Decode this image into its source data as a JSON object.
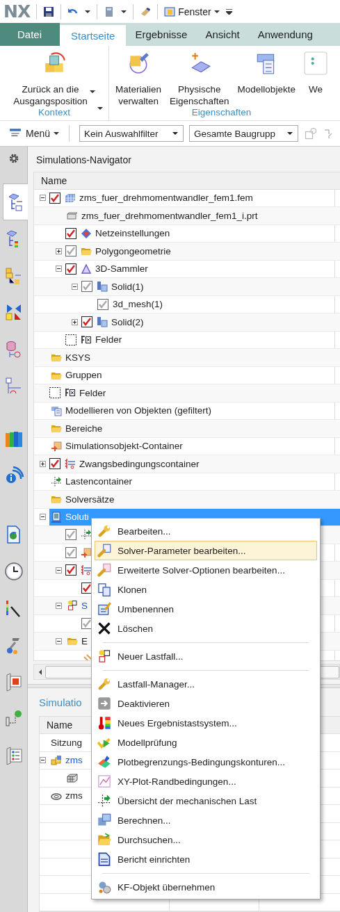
{
  "quick_access": {
    "logo": "NX",
    "window_menu": "Fenster"
  },
  "tabs": [
    {
      "label": "Datei",
      "kind": "file",
      "selected": false
    },
    {
      "label": "Startseite",
      "kind": "tab",
      "selected": true
    },
    {
      "label": "Ergebnisse",
      "kind": "tab",
      "selected": false
    },
    {
      "label": "Ansicht",
      "kind": "tab",
      "selected": false
    },
    {
      "label": "Anwendung",
      "kind": "tab",
      "selected": false
    }
  ],
  "ribbon": {
    "groups": [
      {
        "label": "Kontext",
        "launcher": true,
        "buttons": [
          {
            "kind": "home",
            "lines": [
              "Zurück an die",
              "Ausgangsposition"
            ],
            "dropdown": true
          }
        ]
      },
      {
        "label": "Eigenschaften",
        "buttons": [
          {
            "kind": "material",
            "lines": [
              "Materialien",
              "verwalten"
            ]
          },
          {
            "kind": "physical",
            "lines": [
              "Physische",
              "Eigenschaften"
            ]
          },
          {
            "kind": "model",
            "lines": [
              "Modellobjekte"
            ]
          },
          {
            "kind": "more",
            "lines": [
              "We"
            ]
          }
        ]
      }
    ]
  },
  "toolbar": {
    "menu": "Menü",
    "selection_filter": "Kein Auswahlfilter",
    "scope": "Gesamte Baugrupp"
  },
  "sidebar": {
    "items": [
      {
        "kind": "fem_nav",
        "selected": true
      },
      {
        "kind": "result_nav",
        "selected": false
      },
      {
        "kind": "assembly",
        "selected": false
      },
      {
        "kind": "symmetry",
        "selected": false
      },
      {
        "kind": "database",
        "selected": false
      },
      {
        "kind": "graph",
        "selected": false
      },
      {
        "kind": "books",
        "selected": false
      },
      {
        "kind": "info",
        "selected": false
      },
      {
        "kind": "globe_doc",
        "selected": false
      },
      {
        "kind": "clock",
        "selected": false
      },
      {
        "kind": "colorbar",
        "selected": false
      },
      {
        "kind": "tools",
        "selected": false
      },
      {
        "kind": "window",
        "selected": false
      },
      {
        "kind": "connect",
        "selected": false
      },
      {
        "kind": "list",
        "selected": false
      }
    ]
  },
  "navigator": {
    "title": "Simulations-Navigator",
    "column": "Name",
    "rows": [
      {
        "kind": "fem",
        "text": "zms_fuer_drehmomentwandler_fem1.fem",
        "checked": true,
        "dimmed": false,
        "expanded": true,
        "selected": false,
        "active": false,
        "children": [
          {
            "kind": "part",
            "text": "zms_fuer_drehmomentwandler_fem1_i.prt",
            "selected": false,
            "active": false
          },
          {
            "kind": "mesh",
            "text": "Netzeinstellungen",
            "checked": true,
            "dimmed": false,
            "selected": false,
            "active": false
          },
          {
            "kind": "folder",
            "text": "Polygongeometrie",
            "checked": true,
            "dimmed": true,
            "expanded": false,
            "selected": false,
            "active": false
          },
          {
            "kind": "collector",
            "text": "3D-Sammler",
            "checked": true,
            "dimmed": false,
            "expanded": true,
            "selected": false,
            "active": false,
            "children": [
              {
                "kind": "solid",
                "text": "Solid(1)",
                "checked": true,
                "dimmed": true,
                "expanded": true,
                "selected": false,
                "active": false,
                "children": [
                  {
                    "text": "3d_mesh(1)",
                    "checked": true,
                    "dimmed": true,
                    "selected": false,
                    "active": false
                  }
                ]
              },
              {
                "kind": "solid",
                "text": "Solid(2)",
                "checked": true,
                "dimmed": false,
                "expanded": false,
                "selected": false,
                "active": false
              }
            ]
          },
          {
            "kind": "field",
            "text": "Felder",
            "checked": false,
            "dimmed": false,
            "selected": false,
            "active": false
          }
        ]
      },
      {
        "kind": "folder",
        "text": "KSYS",
        "selected": false,
        "active": false
      },
      {
        "kind": "folder",
        "text": "Gruppen",
        "selected": false,
        "active": false
      },
      {
        "kind": "field",
        "text": "Felder",
        "checked": false,
        "dimmed": false,
        "selected": false,
        "active": false
      },
      {
        "kind": "model",
        "text": "Modellieren von Objekten (gefiltert)",
        "selected": false,
        "active": false
      },
      {
        "kind": "folder",
        "text": "Bereiche",
        "selected": false,
        "active": false
      },
      {
        "kind": "simobject",
        "text": "Simulationsobjekt-Container",
        "selected": false,
        "active": false
      },
      {
        "kind": "constraint",
        "text": "Zwangsbedingungscontainer",
        "checked": true,
        "dimmed": false,
        "expanded": false,
        "selected": false,
        "active": false
      },
      {
        "kind": "load",
        "text": "Lastencontainer",
        "selected": false,
        "active": false
      },
      {
        "kind": "folder",
        "text": "Solversätze",
        "selected": false,
        "active": false
      },
      {
        "kind": "solution",
        "text": "Soluti",
        "expanded": true,
        "selected": true,
        "active": false,
        "children": [
          {
            "kind": "load",
            "checked": true,
            "dimmed": true,
            "selected": false
          },
          {
            "kind": "simobject",
            "checked": true,
            "dimmed": true,
            "selected": false
          },
          {
            "kind": "constraint",
            "checked": true,
            "dimmed": false,
            "expanded": true,
            "selected": false,
            "children": [
              {
                "checked": true,
                "dimmed": false,
                "selected": false
              }
            ]
          },
          {
            "kind": "subcase",
            "text": "S",
            "expanded": true,
            "selected": false,
            "active": true,
            "children": [
              {
                "checked": true,
                "dimmed": true,
                "selected": false
              }
            ]
          },
          {
            "kind": "folder",
            "text": "E",
            "expanded": true,
            "selected": false,
            "active": false,
            "children": [
              {
                "kind": "result",
                "selected": false
              }
            ]
          }
        ]
      }
    ]
  },
  "session": {
    "title": "Simulatio",
    "column": "Name",
    "rows": [
      {
        "text": "Sitzung",
        "active": false
      },
      {
        "kind": "assembly",
        "text": "zms",
        "active": true,
        "expanded": true,
        "children": [
          {
            "kind": "grid"
          }
        ]
      },
      {
        "kind": "ring",
        "text": "zms",
        "active": false
      }
    ]
  },
  "context_menu": {
    "items": [
      {
        "kind": "item",
        "label": "Bearbeiten...",
        "selected": false
      },
      {
        "kind": "item",
        "label": "Solver-Parameter bearbeiten...",
        "selected": true
      },
      {
        "kind": "item",
        "label": "Erweiterte Solver-Optionen bearbeiten...",
        "selected": false
      },
      {
        "kind": "item",
        "label": "Klonen",
        "selected": false
      },
      {
        "kind": "item",
        "label": "Umbenennen",
        "selected": false
      },
      {
        "kind": "item",
        "label": "Löschen",
        "selected": false
      },
      {
        "kind": "separator"
      },
      {
        "kind": "item",
        "label": "Neuer Lastfall...",
        "selected": false
      },
      {
        "kind": "separator"
      },
      {
        "kind": "item",
        "label": "Lastfall-Manager...",
        "selected": false
      },
      {
        "kind": "item",
        "label": "Deaktivieren",
        "selected": false
      },
      {
        "kind": "item",
        "label": "Neues Ergebnistastsystem...",
        "selected": false
      },
      {
        "kind": "item",
        "label": "Modellprüfung",
        "selected": false
      },
      {
        "kind": "item",
        "label": "Plotbegrenzungs-Bedingungskonturen...",
        "selected": false
      },
      {
        "kind": "item",
        "label": "XY-Plot-Randbedingungen...",
        "selected": false
      },
      {
        "kind": "item",
        "label": "Übersicht der mechanischen Last",
        "selected": false
      },
      {
        "kind": "item",
        "label": "Berechnen...",
        "selected": false
      },
      {
        "kind": "item",
        "label": "Durchsuchen...",
        "selected": false
      },
      {
        "kind": "item",
        "label": "Bericht einrichten",
        "selected": false
      },
      {
        "kind": "separator"
      },
      {
        "kind": "item",
        "label": "KF-Objekt übernehmen",
        "selected": false
      }
    ]
  }
}
